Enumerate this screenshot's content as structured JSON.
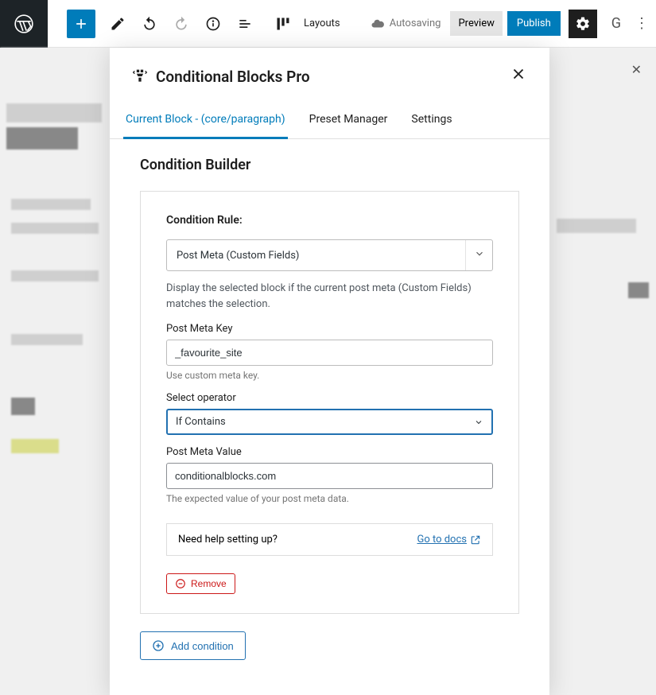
{
  "toolbar": {
    "layouts_label": "Layouts",
    "autosaving_label": "Autosaving",
    "preview_label": "Preview",
    "publish_label": "Publish",
    "letter": "G"
  },
  "modal": {
    "title": "Conditional Blocks Pro",
    "tabs": {
      "current": "Current Block - (core/paragraph)",
      "preset": "Preset Manager",
      "settings": "Settings"
    },
    "builder_title": "Condition Builder",
    "rule": {
      "label": "Condition Rule:",
      "type_value": "Post Meta (Custom Fields)",
      "description": "Display the selected block if the current post meta (Custom Fields) matches the selection.",
      "meta_key_label": "Post Meta Key",
      "meta_key_value": "_favourite_site",
      "meta_key_hint": "Use custom meta key.",
      "operator_label": "Select operator",
      "operator_value": "If Contains",
      "meta_value_label": "Post Meta Value",
      "meta_value_value": "conditionalblocks.com",
      "meta_value_hint": "The expected value of your post meta data.",
      "help_question": "Need help setting up?",
      "help_link": "Go to docs",
      "remove_label": "Remove"
    },
    "add_label": "Add condition"
  }
}
